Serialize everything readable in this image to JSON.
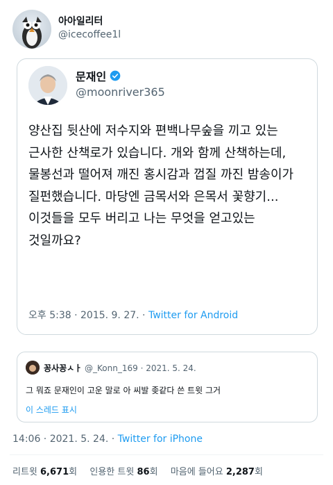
{
  "outer": {
    "display_name": "아아일리터",
    "handle": "@icecoffee1l"
  },
  "quoted_tweet": {
    "display_name": "문재인",
    "handle": "@moonriver365",
    "body": "양산집 뒷산에  저수지와 편백나무숲을 끼고 있는 근사한 산책로가 있습니다. 개와 함께 산책하는데, 물봉선과 떨어져 깨진 홍시감과 껍질 까진 밤송이가 질펀했습니다. 마당엔  금목서와 은목서 꽃향기...이것들을 모두 버리고 나는 무엇을 얻고있는 것일까요?",
    "time": "오후 5:38 · 2015. 9. 27. · ",
    "source": "Twitter for Android"
  },
  "reply": {
    "name": "꽁사꽁ㅅㅏ",
    "handle_date": "@_Konn_169 · 2021. 5. 24.",
    "text": "그 뭐죠 문재인이 고운 말로 아 씨발 좆같다 쓴 트윗 그거",
    "thread_link": "이 스레드 표시"
  },
  "main_meta": {
    "time": "14:06 · 2021. 5. 24. · ",
    "source": "Twitter for iPhone"
  },
  "stats": {
    "retweets_label": "리트윗 ",
    "retweets_value": "6,671",
    "retweets_unit": "회",
    "quotes_label": "인용한 트윗 ",
    "quotes_value": "86",
    "quotes_unit": "회",
    "likes_label": "마음에 들어요 ",
    "likes_value": "2,287",
    "likes_unit": "회"
  },
  "colors": {
    "link": "#1d9bf0",
    "verified": "#1d9bf0",
    "secondary_text": "#536471",
    "border": "#cfd9de"
  },
  "icons": [
    "verified-badge-icon"
  ]
}
